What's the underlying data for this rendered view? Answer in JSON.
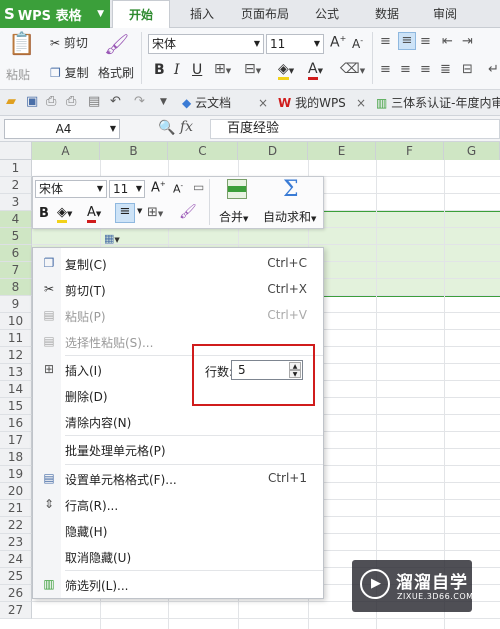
{
  "app": {
    "name": "WPS 表格"
  },
  "tabs": [
    "开始",
    "插入",
    "页面布局",
    "公式",
    "数据",
    "审阅"
  ],
  "ribbon": {
    "paste": "粘贴",
    "cut": "剪切",
    "copy": "复制",
    "format_painter": "格式刷",
    "font_name": "宋体",
    "font_size": "11",
    "bold": "B",
    "italic": "I",
    "underline": "U",
    "grow": "A+",
    "shrink": "A-"
  },
  "quick_access": {
    "doc_tabs": [
      "云文档",
      "我的WPS",
      "三体系认证-年度内审"
    ]
  },
  "formula_bar": {
    "cell_ref": "A4",
    "fx": "fx",
    "value": "百度经验"
  },
  "sheet": {
    "columns": [
      "A",
      "B",
      "C",
      "D",
      "E",
      "F",
      "G"
    ],
    "rows": [
      "1",
      "2",
      "3",
      "4",
      "5",
      "6",
      "7",
      "8",
      "9",
      "10",
      "11",
      "12",
      "13",
      "14",
      "15",
      "16",
      "17",
      "18",
      "19",
      "20",
      "21",
      "22",
      "23",
      "24",
      "25",
      "26",
      "27"
    ]
  },
  "mini_toolbar": {
    "font_name": "宋体",
    "font_size": "11",
    "merge": "合并",
    "autosum": "自动求和"
  },
  "context_menu": {
    "items": [
      {
        "label": "复制(C)",
        "shortcut": "Ctrl+C",
        "icon": "copy-icon",
        "disabled": false
      },
      {
        "label": "剪切(T)",
        "shortcut": "Ctrl+X",
        "icon": "scissors-icon",
        "disabled": false
      },
      {
        "label": "粘贴(P)",
        "shortcut": "Ctrl+V",
        "icon": "paste-icon",
        "disabled": true
      },
      {
        "label": "选择性粘贴(S)...",
        "shortcut": "",
        "icon": "paste-special-icon",
        "disabled": true
      },
      {
        "label": "插入(I)",
        "shortcut": "",
        "icon": "insert-rows-icon",
        "disabled": false
      },
      {
        "label": "删除(D)",
        "shortcut": "",
        "icon": "",
        "disabled": false
      },
      {
        "label": "清除内容(N)",
        "shortcut": "",
        "icon": "",
        "disabled": false
      },
      {
        "label": "批量处理单元格(P)",
        "shortcut": "",
        "icon": "",
        "disabled": false
      },
      {
        "label": "设置单元格格式(F)...",
        "shortcut": "Ctrl+1",
        "icon": "format-cells-icon",
        "disabled": false
      },
      {
        "label": "行高(R)...",
        "shortcut": "",
        "icon": "row-height-icon",
        "disabled": false
      },
      {
        "label": "隐藏(H)",
        "shortcut": "",
        "icon": "",
        "disabled": false
      },
      {
        "label": "取消隐藏(U)",
        "shortcut": "",
        "icon": "",
        "disabled": false
      },
      {
        "label": "筛选列(L)...",
        "shortcut": "",
        "icon": "filter-columns-icon",
        "disabled": false
      }
    ],
    "row_count_label": "行数:",
    "row_count_value": "5"
  },
  "watermark": {
    "title": "溜溜自学",
    "subtitle": "ZIXUE.3D66.COM"
  },
  "colors": {
    "brand_green": "#3b9f3a",
    "selection_green": "#e3f2dc",
    "highlight_red": "#d01c1c"
  }
}
